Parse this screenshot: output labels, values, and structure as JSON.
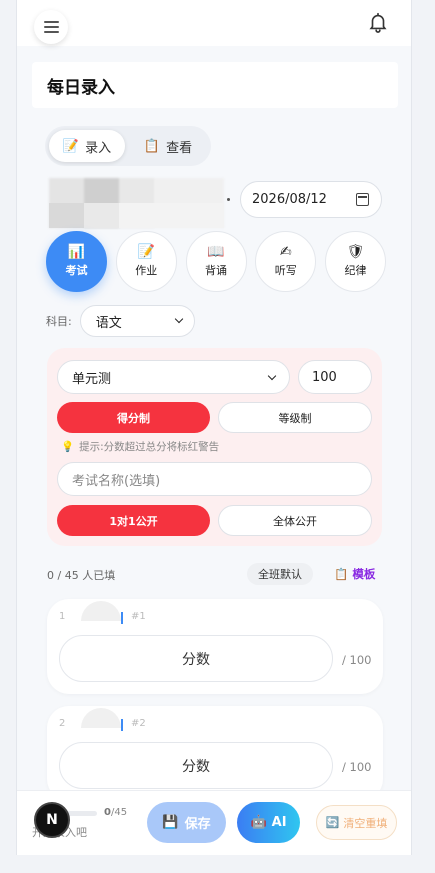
{
  "header": {
    "title": "每日录入"
  },
  "mode_tabs": [
    {
      "label": "录入",
      "icon": "📝"
    },
    {
      "label": "查看",
      "icon": "📋"
    }
  ],
  "date": {
    "value": "2026/08/12"
  },
  "categories": [
    {
      "label": "考试",
      "icon": "📊"
    },
    {
      "label": "作业",
      "icon": "📝"
    },
    {
      "label": "背诵",
      "icon": "📖"
    },
    {
      "label": "听写",
      "icon": "✍"
    },
    {
      "label": "纪律",
      "icon": "🛡"
    }
  ],
  "subject": {
    "label": "科目:",
    "value": "语文"
  },
  "exam": {
    "type": "单元测",
    "max_score": "100",
    "scoring_modes": [
      "得分制",
      "等级制"
    ],
    "hint": "提示:分数超过总分将标红警告",
    "name_placeholder": "考试名称(选填)",
    "visibility": [
      "1对1公开",
      "全体公开"
    ]
  },
  "progress_summary": {
    "count": "0 / 45 人已填",
    "default_label": "全班默认",
    "template_label": "模板"
  },
  "students": [
    {
      "index": "1",
      "id": "#1",
      "score_placeholder": "分数",
      "max": "/ 100"
    },
    {
      "index": "2",
      "id": "#2",
      "score_placeholder": "分数",
      "max": "/ 100"
    }
  ],
  "footer": {
    "progress_done": "0",
    "progress_total": "/45",
    "progress_percent": 0,
    "start_text": "开始录入吧",
    "badge": "N",
    "save_label": "保存",
    "ai_label": "AI",
    "clear_label": "清空重填"
  },
  "colors": {
    "accent_blue": "#3d8bf5",
    "accent_red": "#f5333f",
    "template_purple": "#8a2be2"
  }
}
